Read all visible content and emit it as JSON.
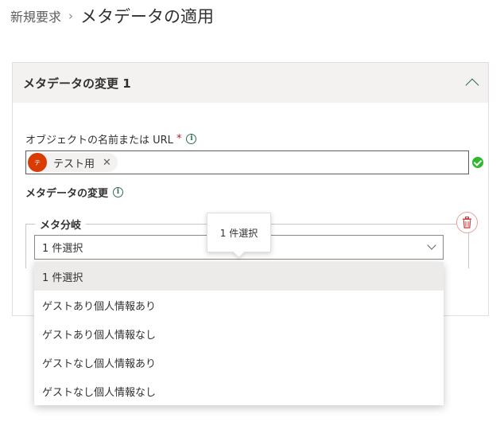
{
  "breadcrumb": {
    "parent": "新規要求",
    "separator": "›",
    "current": "メタデータの適用"
  },
  "card": {
    "title": "メタデータの変更 1"
  },
  "object_field": {
    "label": "オブジェクトの名前または URL",
    "required_marker": "*",
    "selected_item": {
      "avatar_initial": "テ",
      "name": "テスト用",
      "remove_symbol": "✕"
    }
  },
  "metadata_section": {
    "title": "メタデータの変更"
  },
  "meta_branch": {
    "legend": "メタ分岐",
    "dropdown_value": "1 件選択",
    "tooltip_text": "1 件選択",
    "options": [
      {
        "label": "1 件選択",
        "selected": true
      },
      {
        "label": "ゲストあり個人情報あり",
        "selected": false
      },
      {
        "label": "ゲストあり個人情報なし",
        "selected": false
      },
      {
        "label": "ゲストなし個人情報あり",
        "selected": false
      },
      {
        "label": "ゲストなし個人情報なし",
        "selected": false
      }
    ]
  },
  "icons": {
    "info": "info-icon",
    "check": "check-circle-icon",
    "trash": "trash-icon",
    "collapse": "chevron-up-icon",
    "expand": "chevron-down-icon"
  },
  "colors": {
    "accent": "#2f6f4f",
    "avatar": "#da3b01",
    "success": "#2db82d",
    "danger": "#d13438",
    "required": "#a4262c"
  }
}
